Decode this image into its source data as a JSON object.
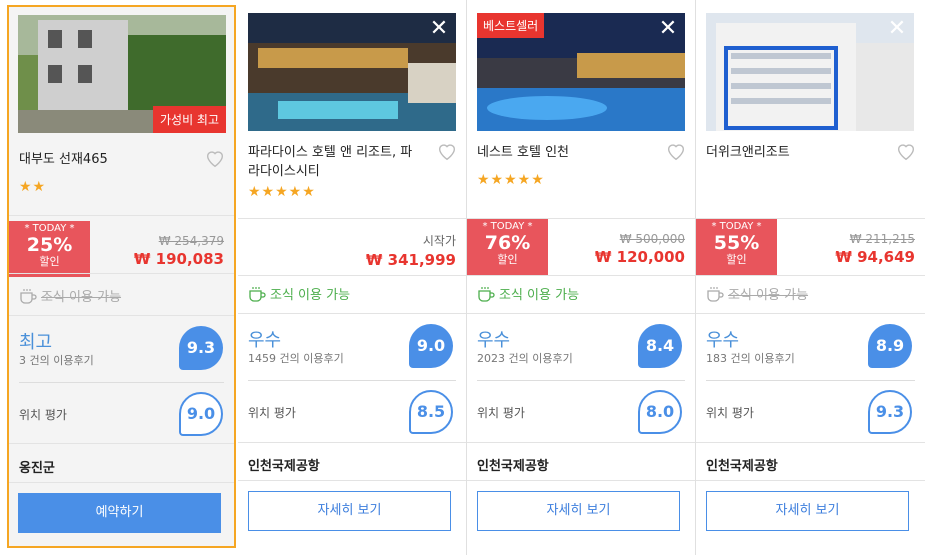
{
  "hotels": [
    {
      "name": "대부도 선재465",
      "badge": "가성비 최고",
      "stars": "★★",
      "today_label": "* TODAY *",
      "discount": "25%",
      "discount_suffix": "할인",
      "original_price": "₩ 254,379",
      "price": "₩ 190,083",
      "breakfast": "조식 이용 가능",
      "rating_word": "최고",
      "reviews": "3 건의 이용후기",
      "score": "9.3",
      "location_label": "위치 평가",
      "location_score": "9.0",
      "area": "옹진군",
      "button": "예약하기"
    },
    {
      "name": "파라다이스 호텔 앤 리조트, 파라다이스시티",
      "stars": "★★★★★",
      "from_label": "시작가",
      "price": "₩ 341,999",
      "breakfast": "조식 이용 가능",
      "rating_word": "우수",
      "reviews": "1459 건의 이용후기",
      "score": "9.0",
      "location_label": "위치 평가",
      "location_score": "8.5",
      "area": "인천국제공항",
      "button": "자세히 보기"
    },
    {
      "name": "네스트 호텔 인천",
      "badge": "베스트셀러",
      "stars": "★★★★★",
      "today_label": "* TODAY *",
      "discount": "76%",
      "discount_suffix": "할인",
      "original_price": "₩ 500,000",
      "price": "₩ 120,000",
      "breakfast": "조식 이용 가능",
      "rating_word": "우수",
      "reviews": "2023 건의 이용후기",
      "score": "8.4",
      "location_label": "위치 평가",
      "location_score": "8.0",
      "area": "인천국제공항",
      "button": "자세히 보기"
    },
    {
      "name": "더위크앤리조트",
      "today_label": "* TODAY *",
      "discount": "55%",
      "discount_suffix": "할인",
      "original_price": "₩ 211,215",
      "price": "₩ 94,649",
      "breakfast": "조식 이용 가능",
      "rating_word": "우수",
      "reviews": "183 건의 이용후기",
      "score": "8.9",
      "location_label": "위치 평가",
      "location_score": "9.3",
      "area": "인천국제공항",
      "button": "자세히 보기"
    }
  ],
  "icons": {
    "close": "close-icon",
    "heart": "heart-icon",
    "breakfast": "coffee-cup-icon"
  },
  "colors": {
    "accent": "#4a8fe7",
    "sale": "#e8352f",
    "selected_border": "#f5a623",
    "breakfast_on": "#4cae4c"
  }
}
